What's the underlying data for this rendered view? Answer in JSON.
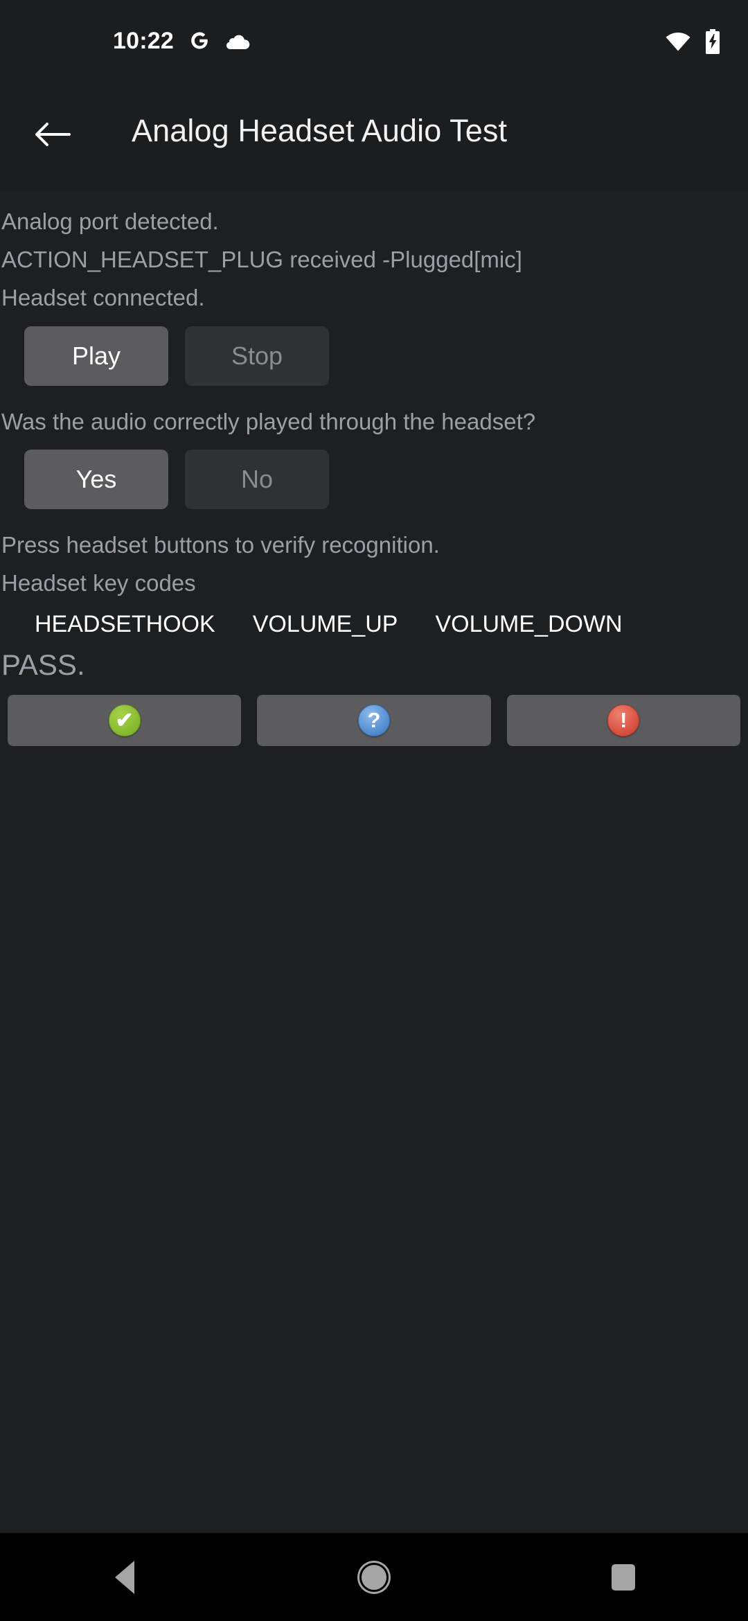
{
  "status_bar": {
    "time": "10:22",
    "icons": [
      "google-g-icon",
      "cloud-icon",
      "wifi-icon",
      "battery-charging-icon"
    ]
  },
  "app_bar": {
    "back_label": "back-arrow-icon",
    "title": "Analog Headset Audio Test"
  },
  "content": {
    "log_lines": [
      "Analog port detected.",
      "ACTION_HEADSET_PLUG received -Plugged[mic]",
      "Headset connected."
    ],
    "play_label": "Play",
    "stop_label": "Stop",
    "question": "Was the audio correctly played through the headset?",
    "yes_label": "Yes",
    "no_label": "No",
    "press_instruction": "Press headset buttons to verify recognition.",
    "keycodes_label": "Headset key codes",
    "keycodes": [
      "HEADSETHOOK",
      "VOLUME_UP",
      "VOLUME_DOWN"
    ],
    "result": "PASS."
  },
  "action_bar": {
    "pass_glyph": "✔",
    "info_glyph": "?",
    "fail_glyph": "!",
    "pass_color": "#8dbf35",
    "info_color": "#5b94d6",
    "fail_color": "#dd5747"
  },
  "nav_bar": {
    "back": "nav-back-icon",
    "home": "nav-home-icon",
    "recents": "nav-recents-icon"
  },
  "theme": {
    "background": "#1e1f21",
    "app_bar_background": "#1c1d1f",
    "nav_background": "#000000",
    "text_muted": "#9aa0a6",
    "text_primary": "#ffffff",
    "button_enabled": "#5c5c5e",
    "button_disabled": "#303133"
  }
}
